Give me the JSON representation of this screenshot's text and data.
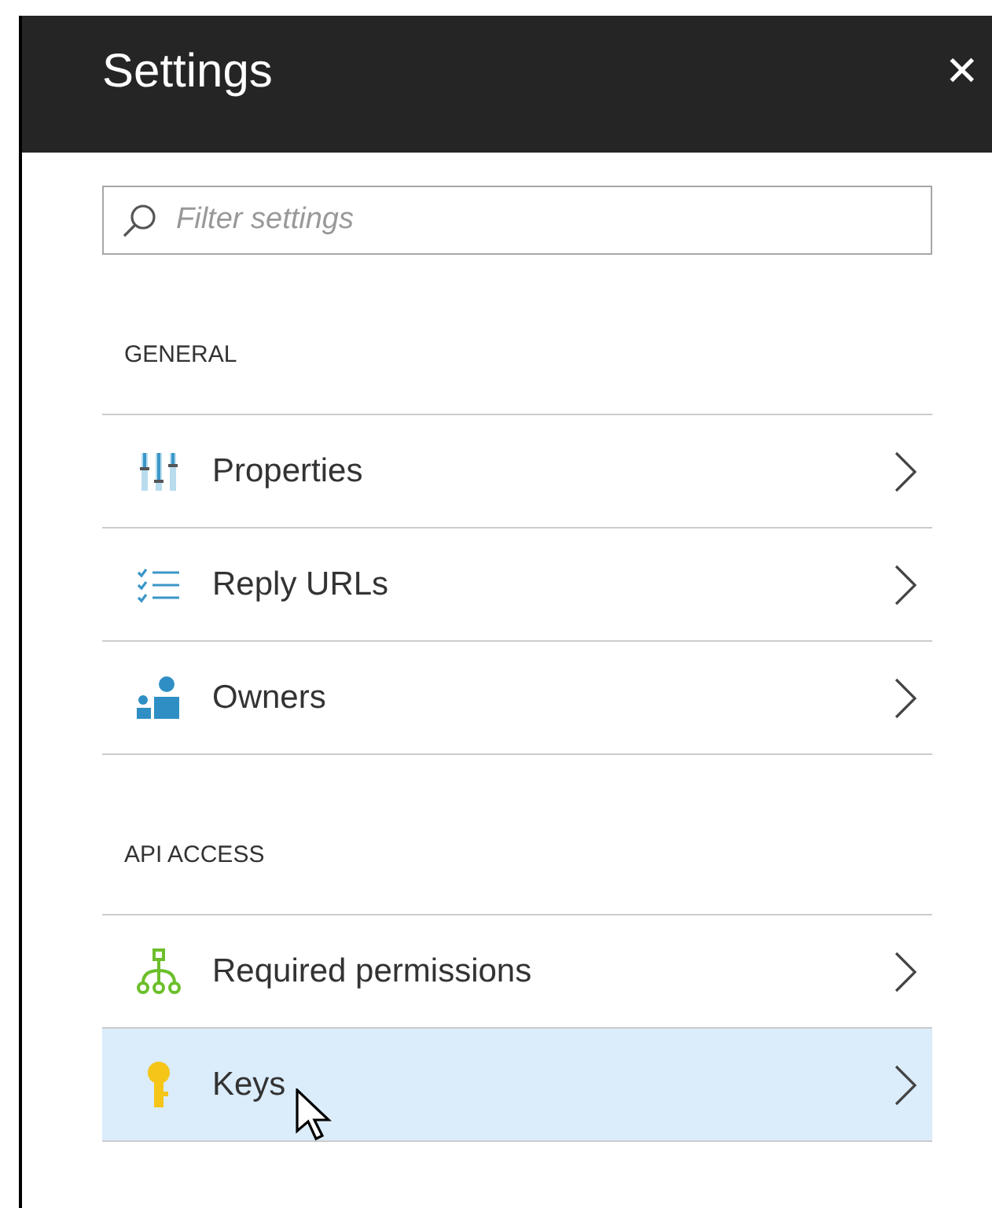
{
  "window": {
    "title": "Settings",
    "close": "✕"
  },
  "search": {
    "placeholder": "Filter settings"
  },
  "sections": [
    {
      "title": "GENERAL",
      "items": [
        {
          "label": "Properties",
          "kind": "sliders",
          "selected": false
        },
        {
          "label": "Reply URLs",
          "kind": "checklist",
          "selected": false
        },
        {
          "label": "Owners",
          "kind": "people",
          "selected": false
        }
      ]
    },
    {
      "title": "API ACCESS",
      "items": [
        {
          "label": "Required permissions",
          "kind": "hierarchy",
          "selected": false
        },
        {
          "label": "Keys",
          "kind": "key",
          "selected": true
        }
      ]
    }
  ]
}
